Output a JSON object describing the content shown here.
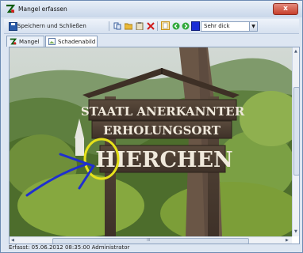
{
  "window": {
    "title": "Mangel erfassen",
    "close_glyph": "x"
  },
  "toolbar": {
    "save_label": "Speichern und Schließen",
    "line_width_value": "Sehr dick",
    "icons": [
      "floppy-icon",
      "copy-icon",
      "folder-icon",
      "clipboard-icon",
      "delete-icon",
      "page-icon",
      "back-icon",
      "forward-icon",
      "color-icon"
    ]
  },
  "tabs": [
    {
      "label": "Mangel",
      "icon": "app-logo-icon"
    },
    {
      "label": "Schadenabild",
      "icon": "image-icon"
    }
  ],
  "photo": {
    "sign_line1": "STAATL ANERKANNTER",
    "sign_line2": "ERHOLUNGSORT",
    "sign_line3": "HIERCHEN",
    "annotation_color": "#e6e21a",
    "arrow_color": "#1f2fcf"
  },
  "scrollbar": {
    "grip": "III"
  },
  "status": {
    "text": "Erfasst: 05.06.2012 08:35:00 Administrator"
  }
}
